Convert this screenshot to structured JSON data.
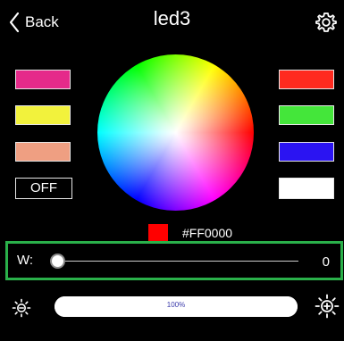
{
  "header": {
    "back_label": "Back",
    "title": "led3",
    "icons": {
      "back": "chevron-left-icon",
      "settings": "gear-icon"
    }
  },
  "presets": {
    "left": [
      {
        "name": "preset-magenta",
        "color": "#e52a8a"
      },
      {
        "name": "preset-yellow",
        "color": "#f2f23c"
      },
      {
        "name": "preset-salmon",
        "color": "#ef9f82"
      }
    ],
    "right": [
      {
        "name": "preset-red",
        "color": "#ff2a1f"
      },
      {
        "name": "preset-green",
        "color": "#44e63a"
      },
      {
        "name": "preset-blue",
        "color": "#2b14f2"
      },
      {
        "name": "preset-white",
        "color": "#ffffff"
      }
    ],
    "off_label": "OFF"
  },
  "current_color": {
    "hex": "#FF0000",
    "label": "#FF0000"
  },
  "white_channel": {
    "label": "W:",
    "value": "0",
    "level": 0,
    "highlight_color": "#2ab04a"
  },
  "brightness": {
    "text": "100%",
    "level": 1.0,
    "icons": {
      "dim": "sun-dim-icon",
      "up": "sun-plus-icon"
    }
  }
}
